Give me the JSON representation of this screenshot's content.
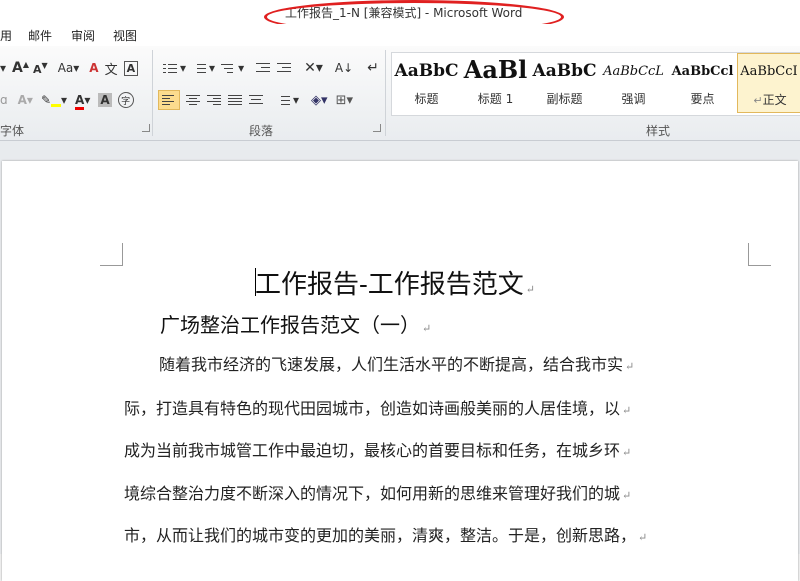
{
  "window": {
    "title": "工作报告_1-N [兼容模式] - Microsoft Word"
  },
  "menu": [
    "用",
    "邮件",
    "审阅",
    "视图"
  ],
  "ribbon": {
    "groups": {
      "font": "字体",
      "paragraph": "段落",
      "styles": "样式"
    },
    "font_tools": {
      "grow": "A",
      "shrink": "A",
      "change_case": "Aa",
      "clear_format": "A",
      "text_highlight": "A",
      "font_color": "A",
      "char_shading": "A",
      "enclose": "字",
      "phonetic": "文"
    },
    "styles": [
      {
        "preview": "AaBbC",
        "name": "标题"
      },
      {
        "preview": "AaBl",
        "name": "标题 1"
      },
      {
        "preview": "AaBbC",
        "name": "副标题"
      },
      {
        "preview": "AaBbCcL",
        "name": "强调"
      },
      {
        "preview": "AaBbCcl",
        "name": "要点"
      },
      {
        "preview": "AaBbCcI",
        "name": "正文"
      }
    ],
    "body_style_mark": "↵"
  },
  "document": {
    "title": "工作报告-工作报告范文",
    "subtitle": "广场整治工作报告范文（一）",
    "paragraph_mark": "↵",
    "lines": [
      "随着我市经济的飞速发展，人们生活水平的不断提高，结合我市实",
      "际，打造具有特色的现代田园城市，创造如诗画般美丽的人居佳境，以",
      "成为当前我市城管工作中最迫切，最核心的首要目标和任务，在城乡环",
      "境综合整治力度不断深入的情况下，如何用新的思维来管理好我们的城",
      "市，从而让我们的城市变的更加的美丽，清爽，整洁。于是，创新思路，"
    ]
  }
}
